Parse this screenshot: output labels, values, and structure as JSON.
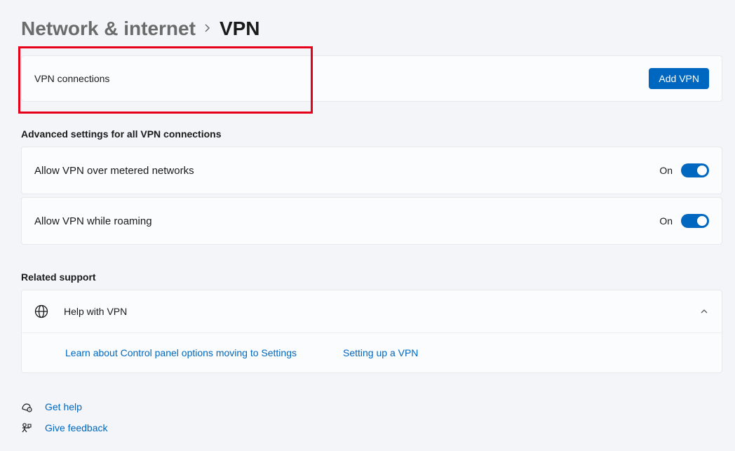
{
  "breadcrumb": {
    "parent": "Network & internet",
    "current": "VPN"
  },
  "vpn_connections": {
    "label": "VPN connections",
    "add_button": "Add VPN"
  },
  "advanced": {
    "heading": "Advanced settings for all VPN connections",
    "metered": {
      "label": "Allow VPN over metered networks",
      "state": "On",
      "value": true
    },
    "roaming": {
      "label": "Allow VPN while roaming",
      "state": "On",
      "value": true
    }
  },
  "related_support": {
    "heading": "Related support",
    "help_title": "Help with VPN",
    "links": {
      "control_panel": "Learn about Control panel options moving to Settings",
      "setup_vpn": "Setting up a VPN"
    }
  },
  "footer": {
    "get_help": "Get help",
    "give_feedback": "Give feedback"
  }
}
